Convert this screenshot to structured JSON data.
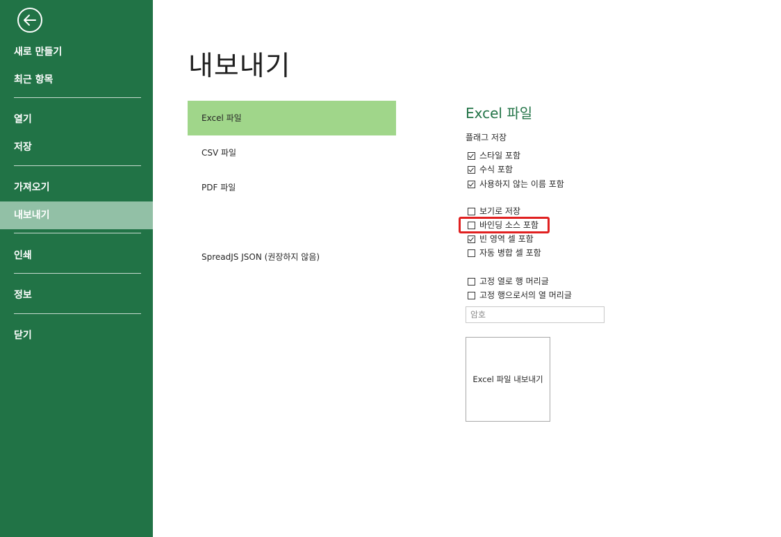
{
  "sidebar": {
    "items": [
      {
        "label": "새로 만들기"
      },
      {
        "label": "최근 항목"
      },
      {
        "label": "열기"
      },
      {
        "label": "저장"
      },
      {
        "label": "가져오기"
      },
      {
        "label": "내보내기",
        "active": true
      },
      {
        "label": "인쇄"
      },
      {
        "label": "정보"
      },
      {
        "label": "닫기"
      }
    ]
  },
  "main": {
    "title": "내보내기"
  },
  "export_types": [
    {
      "label": "Excel 파일",
      "active": true
    },
    {
      "label": "CSV 파일"
    },
    {
      "label": "PDF 파일"
    },
    {
      "label": "SpreadJS JSON (권장하지 않음)"
    }
  ],
  "panel": {
    "title": "Excel 파일",
    "flags_label": "플래그 저장",
    "options": [
      {
        "label": "스타일 포함",
        "checked": true
      },
      {
        "label": "수식 포함",
        "checked": true
      },
      {
        "label": "사용하지 않는 이름 포함",
        "checked": true
      },
      {
        "label": "보기로 저장",
        "checked": false
      },
      {
        "label": "바인딩 소스 포함",
        "checked": false
      },
      {
        "label": "빈 영역 셀 포함",
        "checked": true
      },
      {
        "label": "자동 병합 셀 포함",
        "checked": false
      },
      {
        "label": "고정 열로 행 머리글",
        "checked": false
      },
      {
        "label": "고정 행으로서의 열 머리글",
        "checked": false
      }
    ],
    "password_placeholder": "암호",
    "export_button": "Excel 파일 내보내기"
  },
  "colors": {
    "sidebar_bg": "#217346",
    "sidebar_active": "#92c0a6",
    "type_active": "#a0d68a",
    "highlight": "#e02020"
  }
}
